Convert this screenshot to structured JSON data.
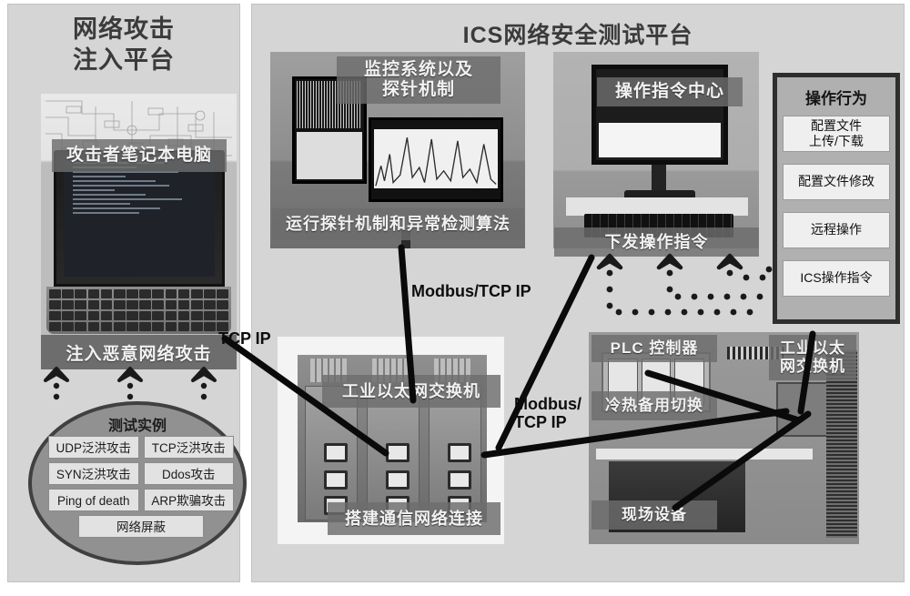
{
  "left_panel": {
    "title_line1": "网络攻击",
    "title_line2": "注入平台",
    "laptop_caption": "攻击者笔记本电脑",
    "inject_bar": "注入恶意网络攻击",
    "ellipse_title": "测试实例",
    "test_cases": [
      "UDP泛洪攻击",
      "TCP泛洪攻击",
      "SYN泛洪攻击",
      "Ddos攻击",
      "Ping of death",
      "ARP欺骗攻击"
    ],
    "test_case_wide": "网络屏蔽"
  },
  "right_panel": {
    "title": "ICS网络安全测试平台",
    "monitoring": {
      "overlay_line1": "监控系统以及",
      "overlay_line2": "探针机制",
      "caption": "运行探针机制和异常检测算法"
    },
    "command_center": {
      "overlay": "操作指令中心",
      "caption": "下发操作指令"
    },
    "switch": {
      "overlay": "工业以太网交换机",
      "caption": "搭建通信网络连接"
    },
    "plc": {
      "controller": "PLC 控制器",
      "switch_line1": "工业以太",
      "switch_line2": "网交换机",
      "standby": "冷热备用切换",
      "field_device": "现场设备"
    },
    "operations": {
      "title": "操作行为",
      "items": [
        {
          "line1": "配置文件",
          "line2": "上传/下载"
        },
        {
          "line1": "配置文件修改",
          "line2": ""
        },
        {
          "line1": "远程操作",
          "line2": ""
        },
        {
          "line1": "ICS操作指令",
          "line2": ""
        }
      ]
    }
  },
  "links": {
    "tcp_ip": "TCP IP",
    "modbus_tcp_ip": "Modbus/TCP IP",
    "modbus_line1": "Modbus/",
    "modbus_line2": "TCP IP"
  },
  "colors": {
    "panel_bg": "#d5d5d5",
    "caption_bg": "#6c6c6c",
    "ellipse_fill": "#919191",
    "ellipse_border": "#404040",
    "wire": "#0a0a0a"
  }
}
